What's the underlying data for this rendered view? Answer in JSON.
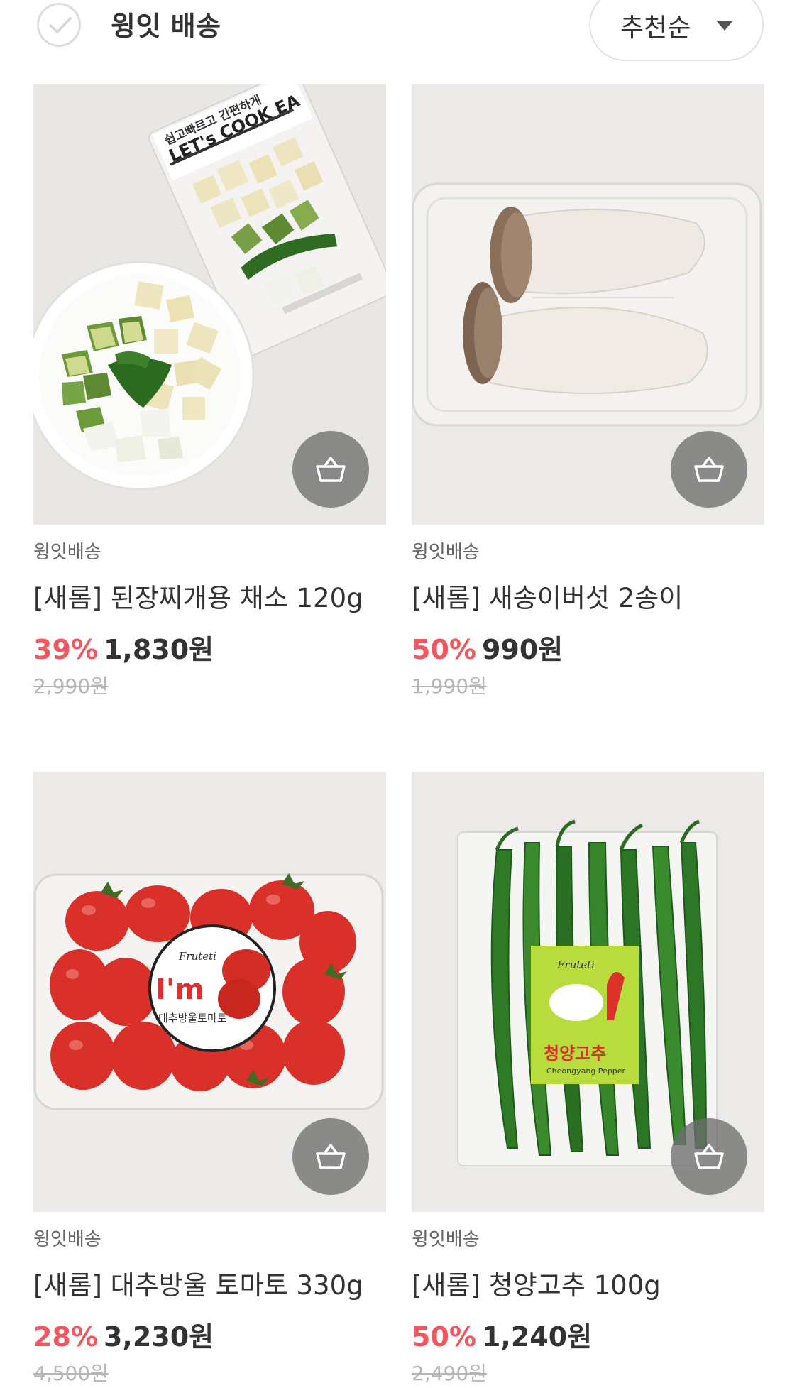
{
  "header": {
    "filter_label": "윙잇 배송",
    "sort_label": "추천순"
  },
  "products": [
    {
      "seller": "윙잇배송",
      "name": "[새롬] 된장찌개용 채소 120g",
      "discount": "39%",
      "price": "1,830원",
      "original_price": "2,990원",
      "image_text_1": "쉽고빠르고 간편하게",
      "image_text_2": "LET's COOK EA"
    },
    {
      "seller": "윙잇배송",
      "name": "[새롬] 새송이버섯 2송이",
      "discount": "50%",
      "price": "990원",
      "original_price": "1,990원"
    },
    {
      "seller": "윙잇배송",
      "name": "[새롬] 대추방울 토마토 330g",
      "discount": "28%",
      "price": "3,230원",
      "original_price": "4,500원",
      "image_text_1": "Fruteti",
      "image_text_2": "I'm",
      "image_text_3": "대추방울토마토"
    },
    {
      "seller": "윙잇배송",
      "name": "[새롬] 청양고추 100g",
      "discount": "50%",
      "price": "1,240원",
      "original_price": "2,490원",
      "image_text_1": "Fruteti",
      "image_text_2": "청양고추",
      "image_text_3": "Cheongyang Pepper"
    }
  ],
  "colors": {
    "discount": "#f2565f",
    "text": "#333333",
    "muted": "#b6b6b6"
  },
  "icons": [
    "check-icon",
    "caret-down-icon",
    "cart-basket-icon"
  ]
}
